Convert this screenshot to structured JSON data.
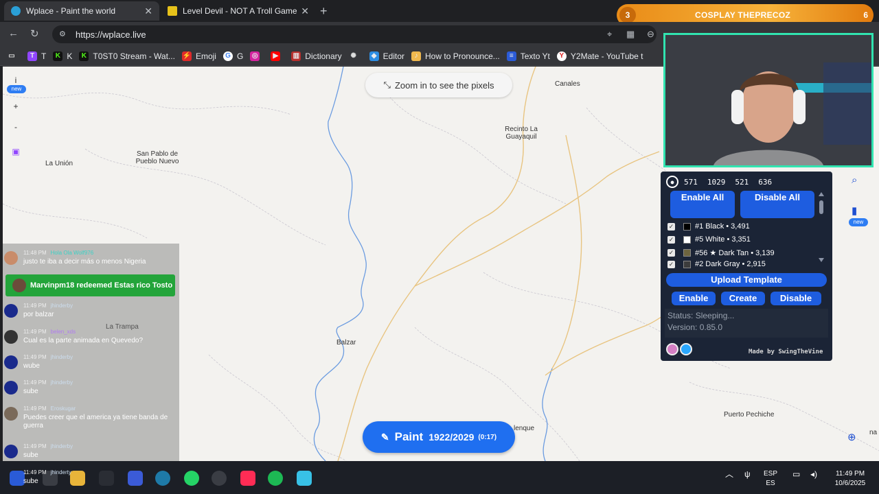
{
  "browser": {
    "tabs": [
      {
        "title": "Wplace - Paint the world",
        "active": true
      },
      {
        "title": "Level Devil - NOT A Troll Game",
        "active": false
      }
    ],
    "url": "https://wplace.live",
    "bookmarks": [
      "T",
      "K",
      "T0ST0 Stream - Wat...",
      "Emoji",
      "G",
      "",
      "",
      "Dictionary",
      "",
      "Editor",
      "How to Pronounce...",
      "Texto Yt",
      "Y2Mate - YouTube t"
    ]
  },
  "banner": {
    "left_num": "3",
    "text": "COSPLAY THEPRECOZ",
    "right_num": "6"
  },
  "map": {
    "zoom_hint": "Zoom in to see the pixels",
    "places": [
      "Canales",
      "Recinto La Guayaquil",
      "San Pablo de Pueblo Nuevo",
      "La Unión",
      "La Trampa",
      "Balzar",
      "lenque",
      "Puerto Pechiche",
      "na"
    ],
    "left_controls": {
      "info": "i",
      "new": "new",
      "zoom_in": "+",
      "zoom_out": "-"
    }
  },
  "chat": {
    "messages": [
      {
        "time": "11:48 PM",
        "name": "Hola Ola Wolf976",
        "text": "justo te iba a decir más o menos Nigeria"
      },
      {
        "time": "11:49 PM",
        "name": "jhinderby",
        "text": "por balzar"
      },
      {
        "time": "11:49 PM",
        "name": "belen_xds",
        "text": "Cual es la parte animada en Quevedo?"
      },
      {
        "time": "11:49 PM",
        "name": "jhinderby",
        "text": "wube"
      },
      {
        "time": "11:49 PM",
        "name": "jhinderby",
        "text": "sube"
      },
      {
        "time": "11:49 PM",
        "name": "Eroskugar",
        "text": "Puedes creer que el america ya tiene banda de guerra"
      },
      {
        "time": "11:49 PM",
        "name": "jhinderby",
        "text": "sube"
      }
    ],
    "redeem": "Marvinpm18 redeemed Estas rico Tosto",
    "bottom": {
      "time": "11:49 PM",
      "name": "jhinderty",
      "text": "sube"
    }
  },
  "paint": {
    "label": "Paint",
    "count": "1922/2029",
    "timer": "(0:17)"
  },
  "template_panel": {
    "coords": [
      "571",
      "1029",
      "521",
      "636"
    ],
    "enable_all": "Enable All",
    "disable_all": "Disable All",
    "colors": [
      {
        "label": "#1 Black • 3,491",
        "hex": "#000000"
      },
      {
        "label": "#5 White • 3,351",
        "hex": "#ffffff"
      },
      {
        "label": "#56 ★ Dark Tan • 3,139",
        "hex": "#6d643f"
      },
      {
        "label": "#2 Dark Gray • 2,915",
        "hex": "#3c3c3c"
      }
    ],
    "upload": "Upload Template",
    "enable": "Enable",
    "create": "Create",
    "disable": "Disable",
    "status": "Status: Sleeping...",
    "version": "Version: 0.85.0",
    "made_by": "Made by SwingTheVine"
  },
  "right_controls": {
    "new": "new"
  },
  "taskbar": {
    "lang1": "ESP",
    "lang2": "ES",
    "time": "11:49 PM",
    "date": "10/6/2025"
  },
  "colors": {
    "accent": "#1f6ff0",
    "panel": "#1b2436",
    "chat_highlight": "#23a43a",
    "banner": "#f0a020"
  }
}
